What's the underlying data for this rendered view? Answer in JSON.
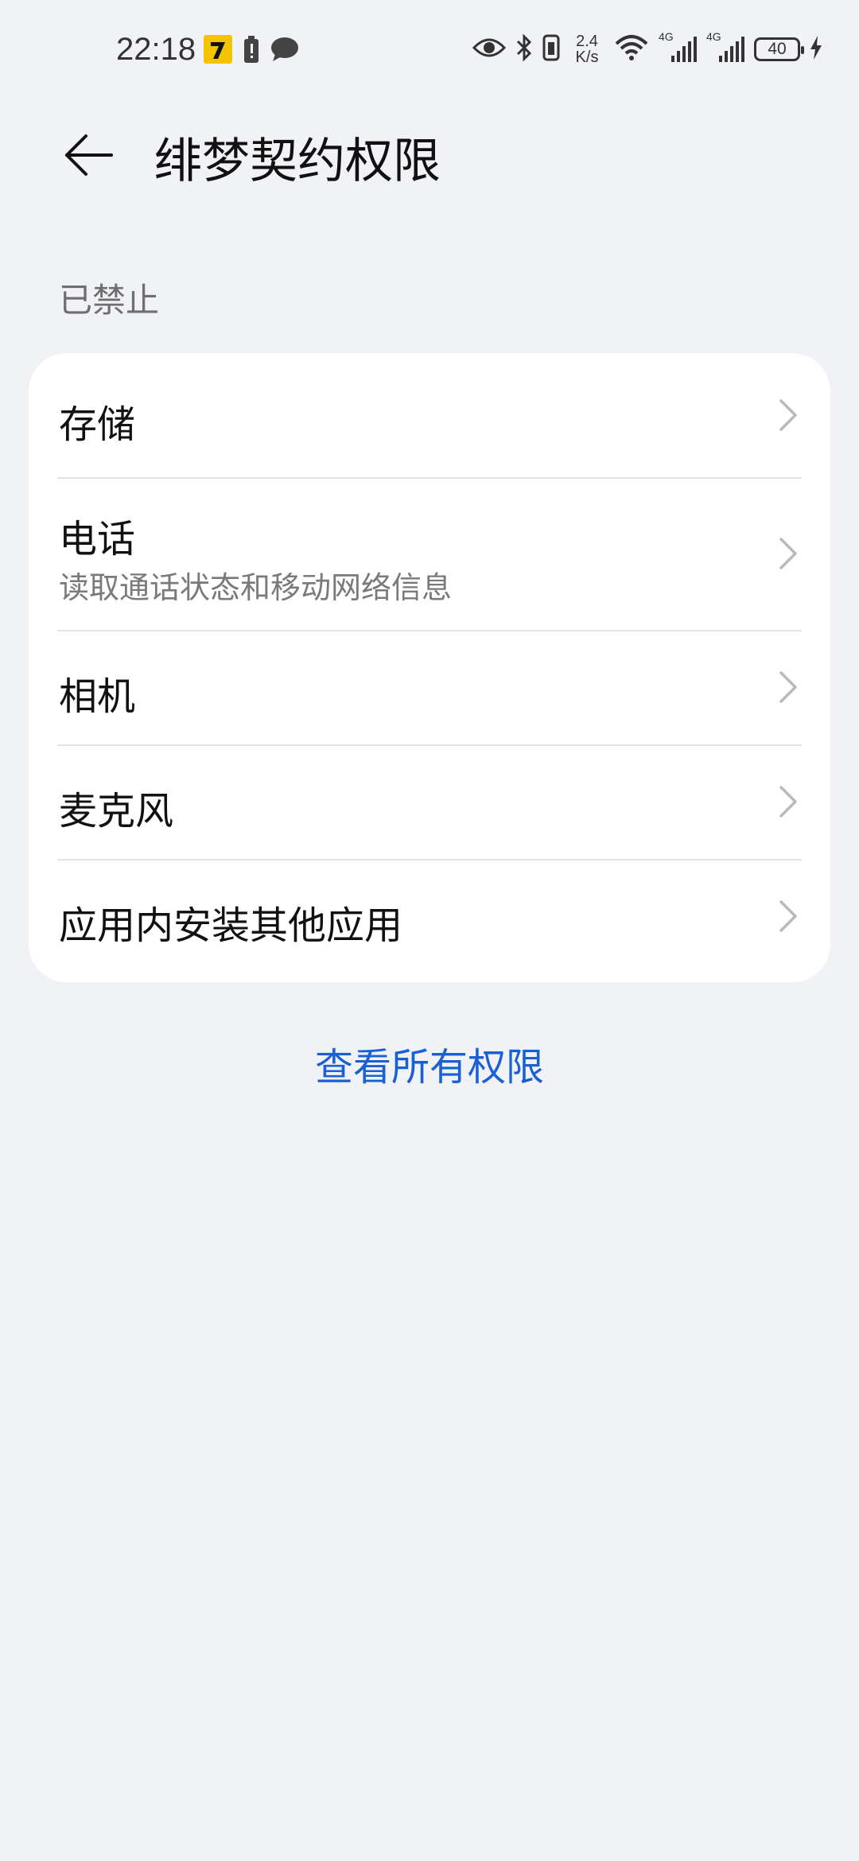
{
  "status_bar": {
    "time": "22:18",
    "net_speed_value": "2.4",
    "net_speed_unit": "K/s",
    "signal1_label": "4G",
    "signal2_label": "4G",
    "battery_level": "40",
    "icons": [
      "app-notification-icon",
      "battery-alert-icon",
      "chat-bubble-icon",
      "eye-icon",
      "bluetooth-icon",
      "vibrate-icon",
      "wifi-icon",
      "signal-icon",
      "signal-icon",
      "battery-icon",
      "charging-icon"
    ]
  },
  "header": {
    "title": "绯梦契约权限"
  },
  "section": {
    "label": "已禁止"
  },
  "permissions": [
    {
      "title": "存储",
      "subtitle": ""
    },
    {
      "title": "电话",
      "subtitle": "读取通话状态和移动网络信息"
    },
    {
      "title": "相机",
      "subtitle": ""
    },
    {
      "title": "麦克风",
      "subtitle": ""
    },
    {
      "title": "应用内安装其他应用",
      "subtitle": ""
    }
  ],
  "footer_link": "查看所有权限",
  "colors": {
    "background": "#f0f2f5",
    "card": "#ffffff",
    "link": "#1a5fd4"
  }
}
